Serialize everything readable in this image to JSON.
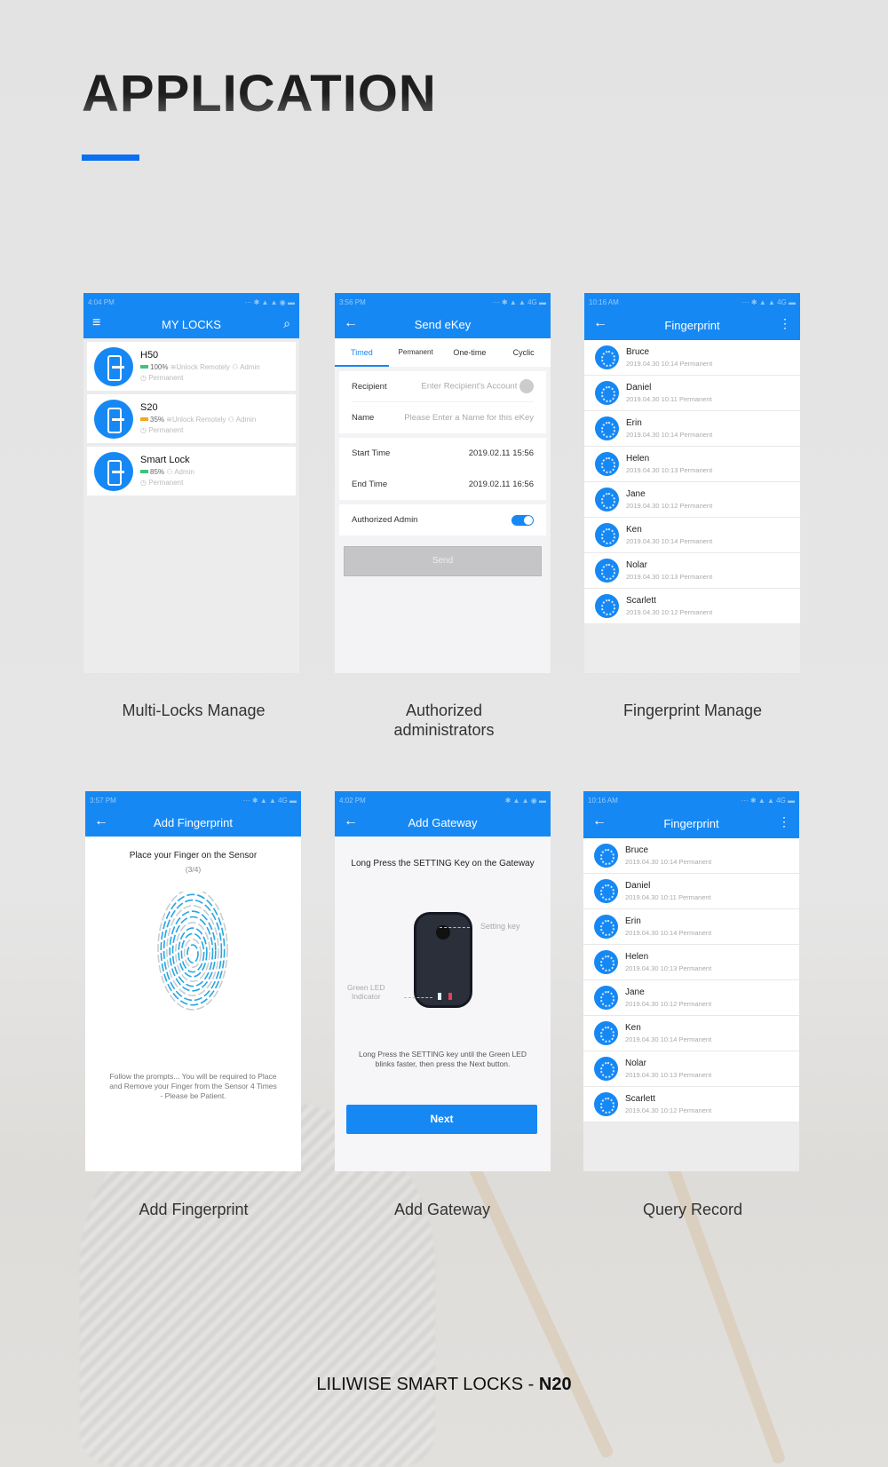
{
  "page": {
    "title": "APPLICATION",
    "accent": "#0a6ff0",
    "footer_brand": "LILIWISE SMART LOCKS - ",
    "footer_model": "N20"
  },
  "captions": [
    "Multi-Locks Manage",
    "Authorized",
    "administrators",
    "Fingerprint Manage",
    "Add Fingerprint",
    "Add Gateway",
    "Query Record"
  ],
  "my_locks": {
    "time": "4:04 PM",
    "title": "MY LOCKS",
    "menu_icon": "hamburger-icon",
    "search_icon": "search-icon",
    "locks": [
      {
        "name": "H50",
        "battery": "100%",
        "battery_color": "#3cc47c",
        "remote": "Unlock Remotely",
        "role": "Admin",
        "validity": "Permanent"
      },
      {
        "name": "S20",
        "battery": "35%",
        "battery_color": "#f5a623",
        "remote": "Unlock Remotely",
        "role": "Admin",
        "validity": "Permanent"
      },
      {
        "name": "Smart Lock",
        "battery": "85%",
        "battery_color": "#3cc47c",
        "remote": "",
        "role": "Admin",
        "validity": "Permanent"
      }
    ]
  },
  "send_ekey": {
    "time": "3:56 PM",
    "title": "Send eKey",
    "tabs": [
      "Timed",
      "Permanent",
      "One-time",
      "Cyclic"
    ],
    "active_tab": "Timed",
    "recipient_label": "Recipient",
    "recipient_placeholder": "Enter Recipient's Account",
    "name_label": "Name",
    "name_placeholder": "Please Enter a Name for this eKey",
    "start_label": "Start Time",
    "start_value": "2019.02.11 15:56",
    "end_label": "End Time",
    "end_value": "2019.02.11 16:56",
    "admin_label": "Authorized Admin",
    "admin_enabled": true,
    "send_label": "Send"
  },
  "fingerprint": {
    "time": "10:16 AM",
    "title": "Fingerprint",
    "items": [
      {
        "name": "Bruce",
        "date": "2019.04.30 10:14",
        "validity": "Permanent"
      },
      {
        "name": "Daniel",
        "date": "2019.04.30 10:11",
        "validity": "Permanent"
      },
      {
        "name": "Erin",
        "date": "2019.04.30 10:14",
        "validity": "Permanent"
      },
      {
        "name": "Helen",
        "date": "2019.04.30 10:13",
        "validity": "Permanent"
      },
      {
        "name": "Jane",
        "date": "2019.04.30 10:12",
        "validity": "Permanent"
      },
      {
        "name": "Ken",
        "date": "2019.04.30 10:14",
        "validity": "Permanent"
      },
      {
        "name": "Nolar",
        "date": "2019.04.30 10:13",
        "validity": "Permanent"
      },
      {
        "name": "Scarlett",
        "date": "2019.04.30 10:12",
        "validity": "Permanent"
      }
    ]
  },
  "add_fingerprint": {
    "time": "3:57 PM",
    "title": "Add Fingerprint",
    "instruction": "Place your Finger on the Sensor",
    "progress": "(3/4)",
    "prompt1": "Follow the prompts... You will be required to Place",
    "prompt2": "and Remove your Finger from the Sensor 4 Times",
    "prompt3": "- Please be Patient."
  },
  "add_gateway": {
    "time": "4:02 PM",
    "title": "Add Gateway",
    "instruction": "Long Press the SETTING Key on the Gateway",
    "setting_key_label": "Setting key",
    "led_label1": "Green LED",
    "led_label2": "Indicator",
    "hint1": "Long Press the SETTING key until the Green LED",
    "hint2": "blinks faster, then press the Next button.",
    "next_label": "Next"
  },
  "query_record": {
    "time": "10:16 AM",
    "title": "Fingerprint"
  }
}
